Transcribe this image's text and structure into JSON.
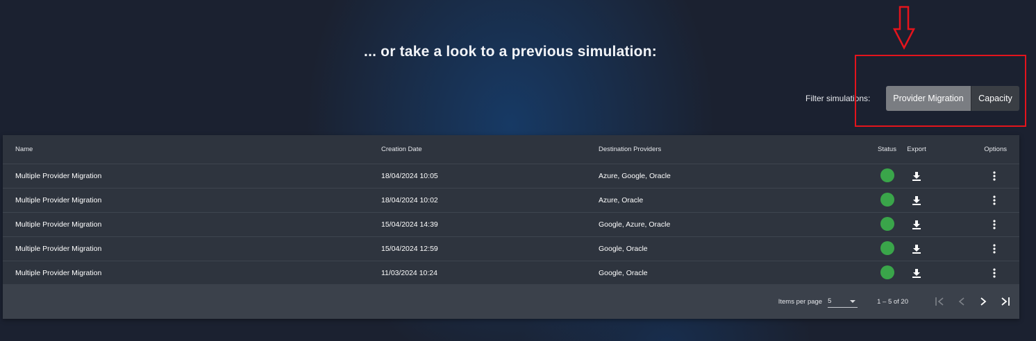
{
  "headline": "... or take a look to a previous simulation:",
  "filter": {
    "label": "Filter simulations:",
    "options": [
      "Provider Migration",
      "Capacity"
    ],
    "selected": "Provider Migration"
  },
  "table": {
    "columns": {
      "name": "Name",
      "creation_date": "Creation Date",
      "destination_providers": "Destination Providers",
      "status": "Status",
      "export": "Export",
      "options": "Options"
    },
    "rows": [
      {
        "name": "Multiple Provider Migration",
        "creation_date": "18/04/2024 10:05",
        "providers": "Azure, Google, Oracle",
        "status": "green"
      },
      {
        "name": "Multiple Provider Migration",
        "creation_date": "18/04/2024 10:02",
        "providers": "Azure, Oracle",
        "status": "green"
      },
      {
        "name": "Multiple Provider Migration",
        "creation_date": "15/04/2024 14:39",
        "providers": "Google, Azure, Oracle",
        "status": "green"
      },
      {
        "name": "Multiple Provider Migration",
        "creation_date": "15/04/2024 12:59",
        "providers": "Google, Oracle",
        "status": "green"
      },
      {
        "name": "Multiple Provider Migration",
        "creation_date": "11/03/2024 10:24",
        "providers": "Google, Oracle",
        "status": "green"
      }
    ]
  },
  "paginator": {
    "items_per_page_label": "Items per page",
    "items_per_page": "5",
    "range": "1 – 5 of 20"
  },
  "colors": {
    "status_ok": "#3aa54a",
    "annotation_red": "#e4141c",
    "toggle_active": "#7a7d82"
  },
  "icons": {
    "export": "download-icon",
    "options": "more-vert-icon",
    "first": "first-page-icon",
    "prev": "chevron-left-icon",
    "next": "chevron-right-icon",
    "last": "last-page-icon"
  }
}
